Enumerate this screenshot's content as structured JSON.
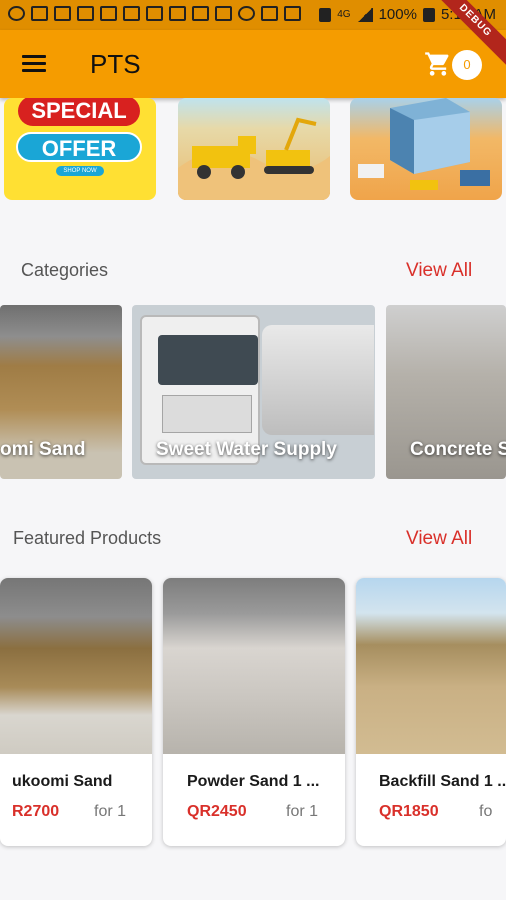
{
  "status_bar": {
    "battery": "100%",
    "time": "5:18 AM",
    "network": "4G"
  },
  "app_bar": {
    "title": "PTS",
    "cart_count": "0",
    "debug_label": "DEBUG"
  },
  "banners": {
    "offer": {
      "line1": "SPECIAL",
      "line2": "OFFER",
      "line3": "SHOP NOW"
    }
  },
  "categories": {
    "title": "Categories",
    "view_all": "View All",
    "items": [
      {
        "label": "omi Sand"
      },
      {
        "label": "Sweet Water Supply"
      },
      {
        "label": "Concrete S"
      }
    ]
  },
  "featured": {
    "title": "Featured Products",
    "view_all": "View All",
    "items": [
      {
        "name": "ukoomi Sand",
        "price": "R2700",
        "unit": "for 1"
      },
      {
        "name": "Powder Sand 1 ...",
        "price": "QR2450",
        "unit": "for 1"
      },
      {
        "name": "Backfill Sand 1 ...",
        "price": "QR1850",
        "unit": "fo"
      }
    ]
  }
}
